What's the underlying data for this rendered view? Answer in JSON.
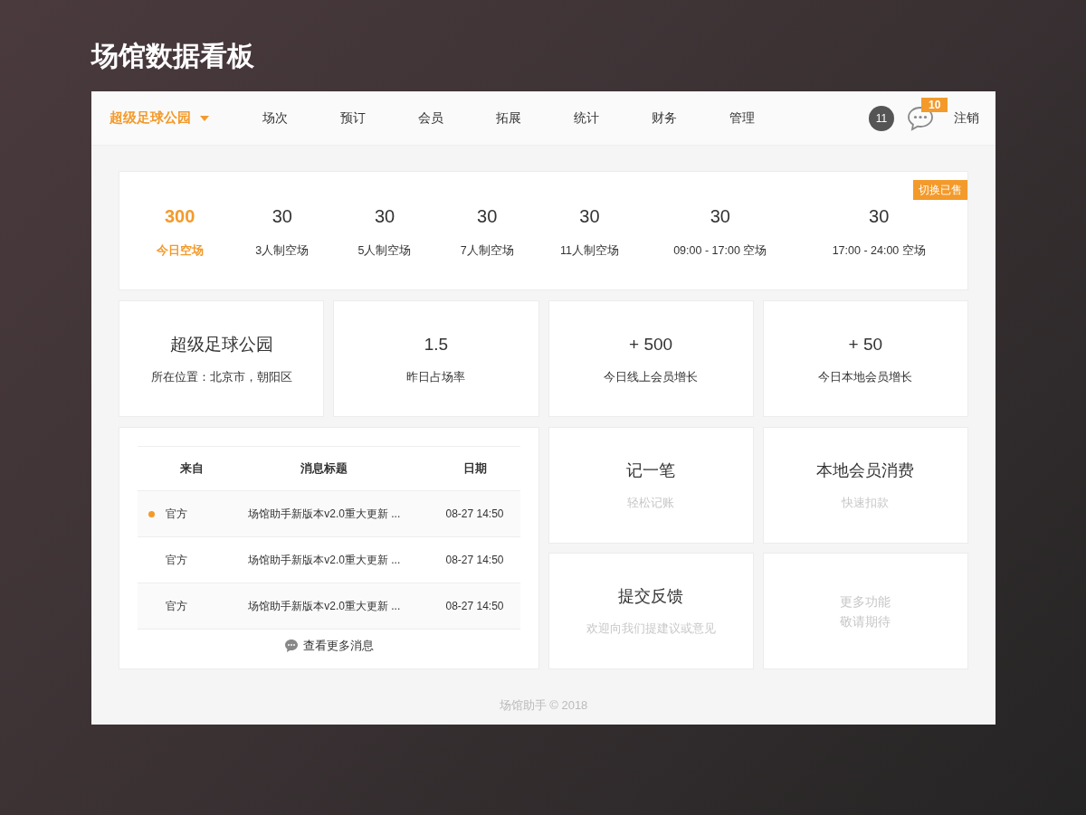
{
  "page_title": "场馆数据看板",
  "nav": {
    "venue": "超级足球公园",
    "items": [
      {
        "label": "场次",
        "selected": false
      },
      {
        "label": "预订",
        "selected": false
      },
      {
        "label": "会员",
        "selected": false
      },
      {
        "label": "拓展",
        "selected": false
      },
      {
        "label": "统计",
        "selected": false
      },
      {
        "label": "财务",
        "selected": false
      },
      {
        "label": "管理",
        "selected": false
      }
    ],
    "notice_count": "11",
    "message_count": "10",
    "logout": "注销"
  },
  "stats_card": {
    "switch_label": "切换已售",
    "stats": [
      {
        "value": "300",
        "label": "今日空场",
        "selected": true
      },
      {
        "value": "30",
        "label": "3人制空场",
        "selected": false
      },
      {
        "value": "30",
        "label": "5人制空场",
        "selected": false
      },
      {
        "value": "30",
        "label": "7人制空场",
        "selected": false
      },
      {
        "value": "30",
        "label": "11人制空场",
        "selected": false
      },
      {
        "value": "30",
        "label": "09:00 - 17:00 空场",
        "selected": false
      },
      {
        "value": "30",
        "label": "17:00 - 24:00 空场",
        "selected": false
      }
    ]
  },
  "info_cards": [
    {
      "value": "超级足球公园",
      "label": "所在位置：北京市，朝阳区"
    },
    {
      "value": "1.5",
      "label": "昨日占场率"
    },
    {
      "value": "+ 500",
      "label": "今日线上会员增长"
    },
    {
      "value": "+ 50",
      "label": "今日本地会员增长"
    }
  ],
  "messages": {
    "columns": [
      "来自",
      "消息标题",
      "日期"
    ],
    "rows": [
      {
        "from": "官方",
        "title": "场馆助手新版本v2.0重大更新 ...",
        "date": "08-27 14:50",
        "unread": true
      },
      {
        "from": "官方",
        "title": "场馆助手新版本v2.0重大更新 ...",
        "date": "08-27 14:50",
        "unread": false
      },
      {
        "from": "官方",
        "title": "场馆助手新版本v2.0重大更新 ...",
        "date": "08-27 14:50",
        "unread": false
      }
    ],
    "more_link": "查看更多消息"
  },
  "action_cards": [
    {
      "kind": "action",
      "title": "记一笔",
      "subtitle": "轻松记账"
    },
    {
      "kind": "action",
      "title": "本地会员消费",
      "subtitle": "快速扣款"
    },
    {
      "kind": "action",
      "title": "提交反馈",
      "subtitle": "欢迎向我们提建议或意见"
    },
    {
      "kind": "placeholder",
      "lines": [
        "更多功能",
        "敬请期待"
      ]
    }
  ],
  "footer": "场馆助手 © 2018"
}
